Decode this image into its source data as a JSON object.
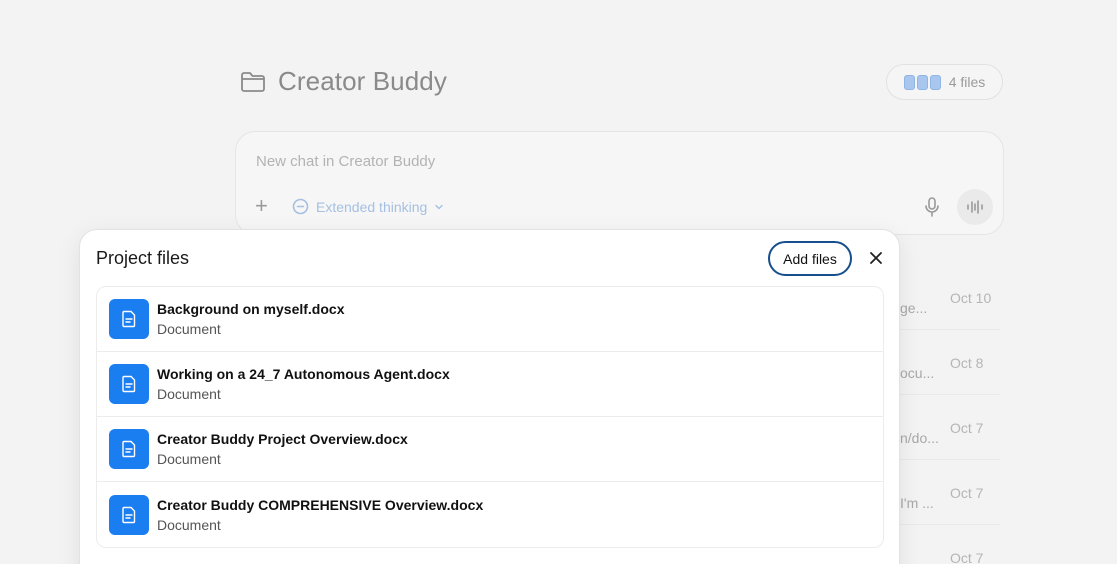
{
  "project": {
    "title": "Creator Buddy",
    "files_count_label": "4 files"
  },
  "composer": {
    "placeholder": "New chat in Creator Buddy",
    "extended_thinking_label": "Extended thinking"
  },
  "background_chats": [
    {
      "snippet": "ge...",
      "date": "Oct 10"
    },
    {
      "snippet": "ocu...",
      "date": "Oct 8"
    },
    {
      "snippet": "n/do...",
      "date": "Oct 7"
    },
    {
      "snippet": "I'm ...",
      "date": "Oct 7"
    },
    {
      "snippet": "",
      "date": "Oct 7"
    }
  ],
  "modal": {
    "title": "Project files",
    "add_files_label": "Add files",
    "files": [
      {
        "name": "Background on myself.docx",
        "type": "Document"
      },
      {
        "name": "Working on a 24_7 Autonomous Agent.docx",
        "type": "Document"
      },
      {
        "name": "Creator Buddy Project Overview.docx",
        "type": "Document"
      },
      {
        "name": "Creator Buddy COMPREHENSIVE Overview.docx",
        "type": "Document"
      }
    ]
  },
  "colors": {
    "accent": "#1a7df0",
    "button_border": "#174e8c"
  }
}
